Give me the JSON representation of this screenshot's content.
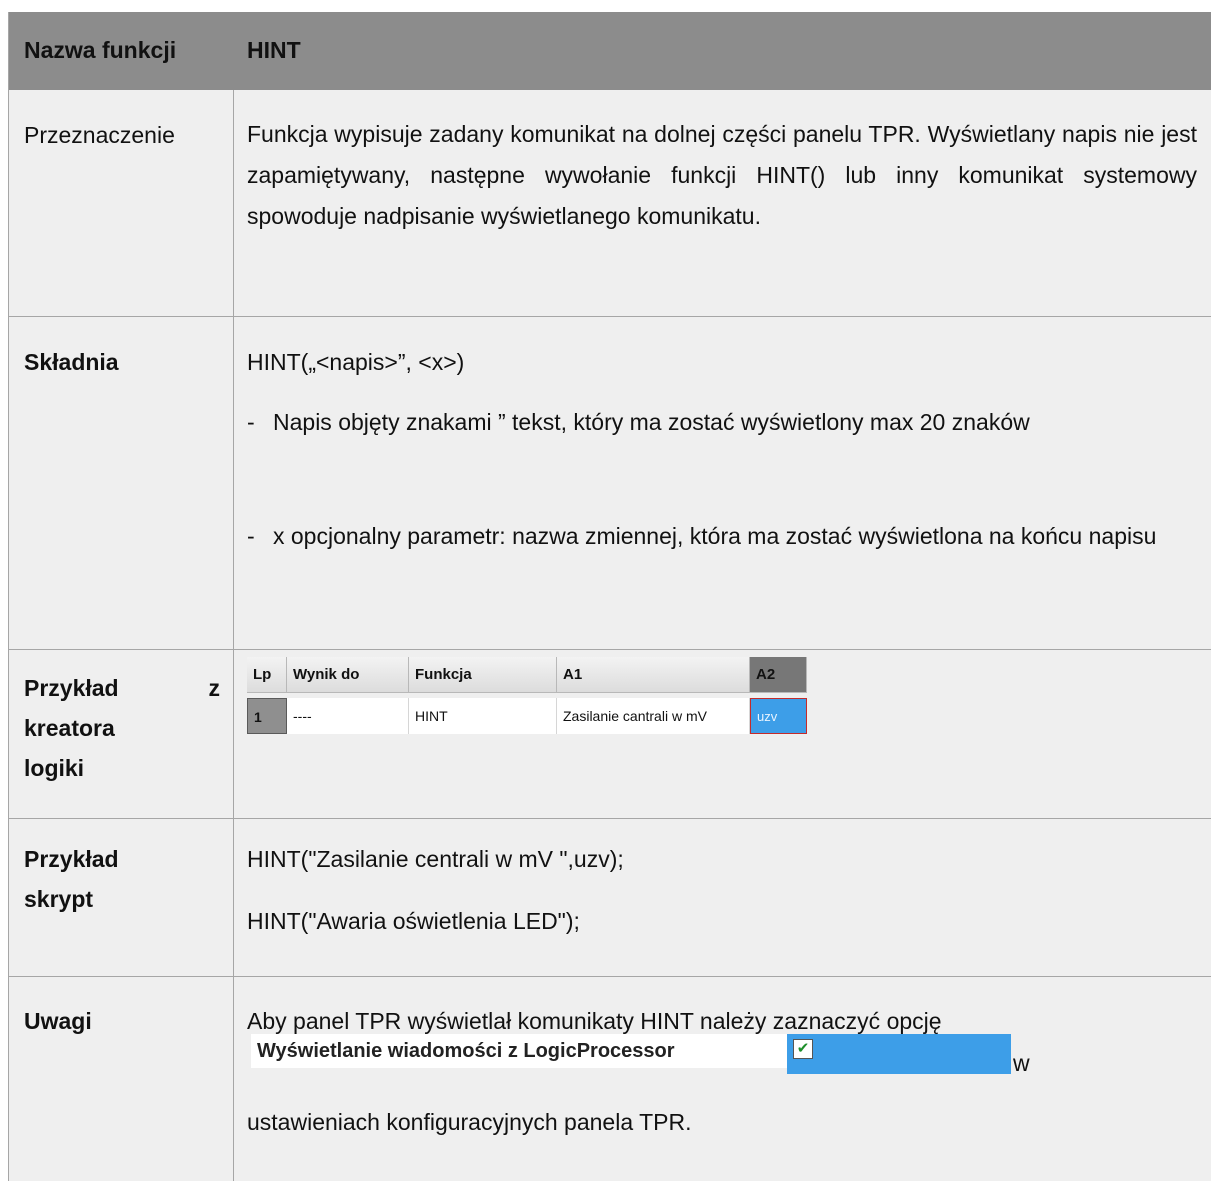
{
  "header": {
    "label": "Nazwa funkcji",
    "value": "HINT"
  },
  "purpose": {
    "label": "Przeznaczenie",
    "text": "Funkcja wypisuje zadany komunikat na dolnej części panelu TPR. Wyświetlany napis nie jest zapamiętywany, następne wywołanie funkcji HINT() lub inny komunikat systemowy spowoduje nadpisanie wyświetlanego komunikatu."
  },
  "syntax": {
    "label": "Składnia",
    "signature": "HINT(„<napis>”, <x>)",
    "bullets": [
      {
        "dash": "-",
        "text": "Napis objęty znakami ” tekst, który ma zostać wyświetlony max 20 znaków"
      },
      {
        "dash": "-",
        "text": "x opcjonalny parametr: nazwa zmiennej, która ma zostać wyświetlona na końcu napisu"
      }
    ]
  },
  "logic_example": {
    "label": "Przykład z kreatora logiki",
    "label_line1_a": "Przykład",
    "label_line1_b": "z",
    "label_line2": "kreatora",
    "label_line3": "logiki",
    "table": {
      "headers": [
        "Lp",
        "Wynik do",
        "Funkcja",
        "A1",
        "A2"
      ],
      "row": [
        "1",
        "----",
        "HINT",
        "Zasilanie cantrali w mV",
        "uzv"
      ]
    }
  },
  "script_example": {
    "label_line1": "Przykład",
    "label_line2": "skrypt",
    "lines": [
      "HINT(\"Zasilanie centrali w mV \",uzv);",
      "HINT(\"Awaria oświetlenia LED\");"
    ]
  },
  "notes": {
    "label": "Uwagi",
    "text1": "Aby panel TPR wyświetlał komunikaty HINT należy zaznaczyć opcję",
    "option_label": "Wyświetlanie wiadomości z LogicProcessor",
    "option_checked": true,
    "option_tail": "w",
    "text2": "ustawieniach konfiguracyjnych panela TPR."
  }
}
